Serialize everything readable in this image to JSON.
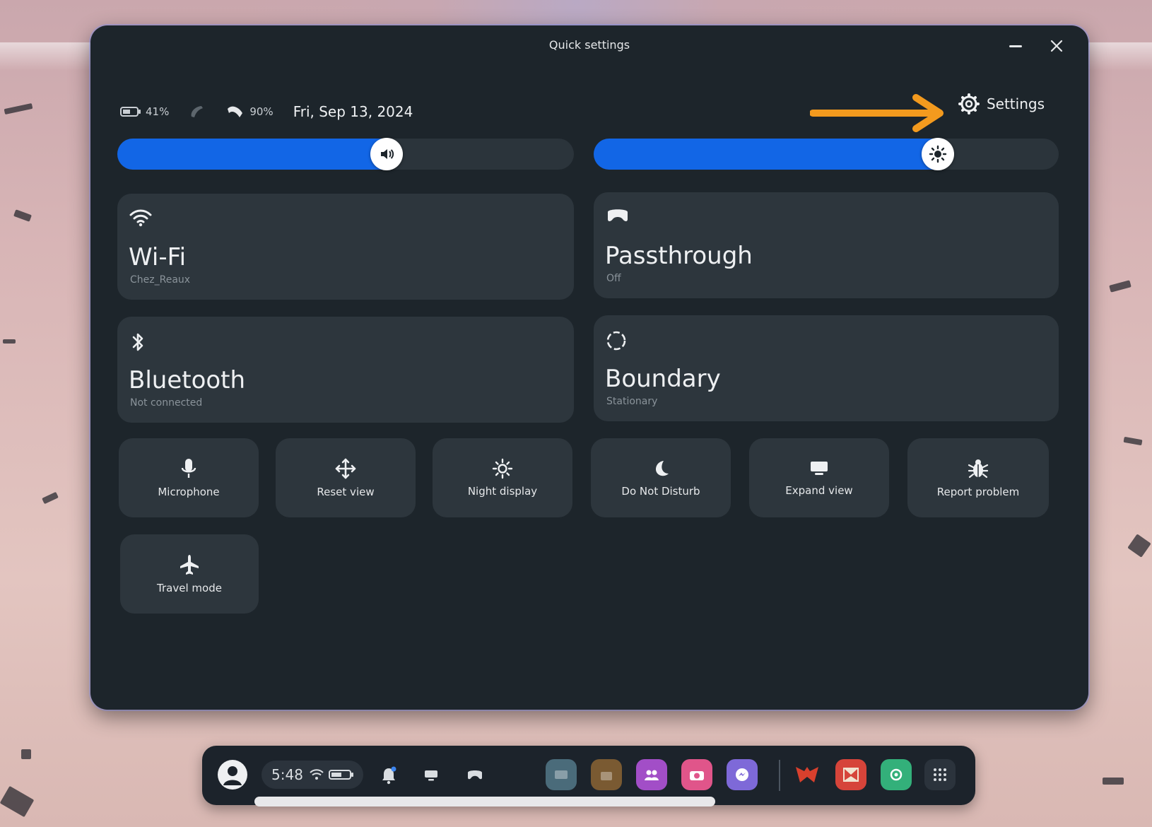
{
  "window": {
    "title": "Quick settings",
    "minimize_glyph": "—",
    "close_glyph": "✕"
  },
  "status": {
    "battery_percent": "41%",
    "controller_battery_percent": "90%",
    "date": "Fri, Sep 13, 2024"
  },
  "settings_link": {
    "label": "Settings"
  },
  "annotation": {
    "arrow_color": "#f39a1e"
  },
  "sliders": {
    "volume": {
      "level": 0.59,
      "icon": "volume-icon"
    },
    "brightness": {
      "level": 0.74,
      "icon": "brightness-icon"
    }
  },
  "tiles": {
    "wifi": {
      "label": "Wi-Fi",
      "sub": "Chez_Reaux",
      "icon": "wifi-icon"
    },
    "passthrough": {
      "label": "Passthrough",
      "sub": "Off",
      "icon": "headset-icon"
    },
    "bluetooth": {
      "label": "Bluetooth",
      "sub": "Not connected",
      "icon": "bluetooth-icon"
    },
    "boundary": {
      "label": "Boundary",
      "sub": "Stationary",
      "icon": "boundary-icon"
    }
  },
  "small_tiles": {
    "microphone": {
      "label": "Microphone",
      "icon": "microphone-icon"
    },
    "reset_view": {
      "label": "Reset view",
      "icon": "move-icon"
    },
    "night_display": {
      "label": "Night display",
      "icon": "brightness-icon"
    },
    "do_not_disturb": {
      "label": "Do Not Disturb",
      "icon": "moon-icon"
    },
    "expand_view": {
      "label": "Expand view",
      "icon": "display-icon"
    },
    "report_problem": {
      "label": "Report problem",
      "icon": "bug-icon"
    },
    "travel_mode": {
      "label": "Travel mode",
      "icon": "airplane-icon"
    }
  },
  "dock": {
    "time": "5:48",
    "apps": [
      {
        "name": "app-gallery",
        "color": "#4a6b7a"
      },
      {
        "name": "app-store",
        "color": "#7a5a32"
      },
      {
        "name": "app-people",
        "color": "#a24ec7"
      },
      {
        "name": "app-camera",
        "color": "#e0558a"
      },
      {
        "name": "app-messenger",
        "color": "#7e69d8"
      },
      {
        "name": "app-red-1",
        "color": "#c23a2b"
      },
      {
        "name": "app-red-2",
        "color": "#d6443a"
      },
      {
        "name": "app-green",
        "color": "#33b07a"
      },
      {
        "name": "app-library",
        "color": "#2b333c"
      }
    ]
  }
}
